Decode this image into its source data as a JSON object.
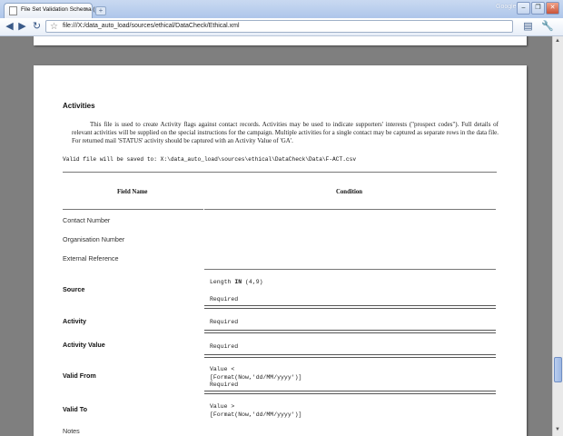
{
  "browser": {
    "tab_title": "File Set Validation Schema (",
    "tab_close": "×",
    "new_tab": "+",
    "google_label": "Google",
    "url": "file:///X:/data_auto_load/sources/ethical/DataCheck/Ethical.xml",
    "toolbar_icons": [
      "back-arrow-icon",
      "forward-arrow-icon",
      "reload-icon",
      "star-icon",
      "page-menu-icon",
      "wrench-menu-icon"
    ]
  },
  "document": {
    "section_title": "Activities",
    "intro": "This file is used to create Activity flags against contact records. Activities may be used to indicate supporters' interests (\"prospect codes\"). Full details of relevant activities will be supplied on the special instructions for the campaign. Multiple activities for a single contact may be captured as separate rows in the data file. For returned mail 'STATUS' activity should be captured with an Activity Value of 'GA'.",
    "valid_file": "Valid file will be saved to: X:\\data_auto_load\\sources\\ethical\\DataCheck\\Data\\F-ACT.csv",
    "col_field": "Field Name",
    "col_condition": "Condition",
    "rows": {
      "contact_number": "Contact Number",
      "organisation_number": "Organisation Number",
      "external_reference": "External Reference",
      "source": "Source",
      "activity": "Activity",
      "activity_value": "Activity Value",
      "valid_from": "Valid From",
      "valid_to": "Valid To",
      "notes": "Notes"
    },
    "conditions": {
      "source_length": "Length",
      "source_in": "IN",
      "source_range": "(4,9)",
      "required": "Required",
      "valid_from": "Value <\n[Format(Now,'dd/MM/yyyy')]\nRequired",
      "valid_to": "Value >\n[Format(Now,'dd/MM/yyyy')]"
    }
  }
}
